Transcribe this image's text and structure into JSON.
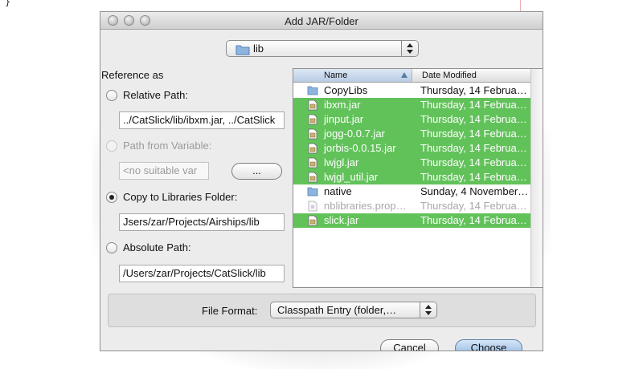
{
  "background": {
    "code_text": "}"
  },
  "dialog": {
    "title": "Add JAR/Folder",
    "folder_popup": {
      "value": "lib",
      "icon": "folder-icon"
    },
    "reference_as_label": "Reference as",
    "options": {
      "relative": {
        "label": "Relative Path:",
        "value": "../CatSlick/lib/ibxm.jar, ../CatSlick",
        "selected": false,
        "enabled": true
      },
      "variable": {
        "label": "Path from Variable:",
        "value": "<no suitable var",
        "browse_label": "...",
        "selected": false,
        "enabled": false
      },
      "copy": {
        "label": "Copy to Libraries Folder:",
        "value": "Jsers/zar/Projects/Airships/lib",
        "selected": true,
        "enabled": true
      },
      "absolute": {
        "label": "Absolute Path:",
        "value": "/Users/zar/Projects/CatSlick/lib",
        "selected": false,
        "enabled": true
      }
    },
    "file_list": {
      "columns": {
        "name": "Name",
        "date": "Date Modified"
      },
      "rows": [
        {
          "name": "CopyLibs",
          "date": "Thursday, 14 Februa…",
          "kind": "folder",
          "selected": false,
          "dim": false
        },
        {
          "name": "ibxm.jar",
          "date": "Thursday, 14 Februa…",
          "kind": "jar",
          "selected": true,
          "dim": false
        },
        {
          "name": "jinput.jar",
          "date": "Thursday, 14 Februa…",
          "kind": "jar",
          "selected": true,
          "dim": false
        },
        {
          "name": "jogg-0.0.7.jar",
          "date": "Thursday, 14 Februa…",
          "kind": "jar",
          "selected": true,
          "dim": false
        },
        {
          "name": "jorbis-0.0.15.jar",
          "date": "Thursday, 14 Februa…",
          "kind": "jar",
          "selected": true,
          "dim": false
        },
        {
          "name": "lwjgl.jar",
          "date": "Thursday, 14 Februa…",
          "kind": "jar",
          "selected": true,
          "dim": false
        },
        {
          "name": "lwjgl_util.jar",
          "date": "Thursday, 14 Februa…",
          "kind": "jar",
          "selected": true,
          "dim": false
        },
        {
          "name": "native",
          "date": "Sunday, 4 November…",
          "kind": "folder",
          "selected": false,
          "dim": false
        },
        {
          "name": "nblibraries.prop…",
          "date": "Thursday, 14 Februa…",
          "kind": "file",
          "selected": false,
          "dim": true
        },
        {
          "name": "slick.jar",
          "date": "Thursday, 14 Februa…",
          "kind": "jar",
          "selected": true,
          "dim": false
        }
      ]
    },
    "file_format": {
      "label": "File Format:",
      "value": "Classpath Entry (folder,…"
    },
    "buttons": {
      "cancel": "Cancel",
      "choose": "Choose"
    },
    "colors": {
      "selection": "#62c25a",
      "folder": "#7fa9d6",
      "default_button": "#8fb5e2"
    }
  }
}
